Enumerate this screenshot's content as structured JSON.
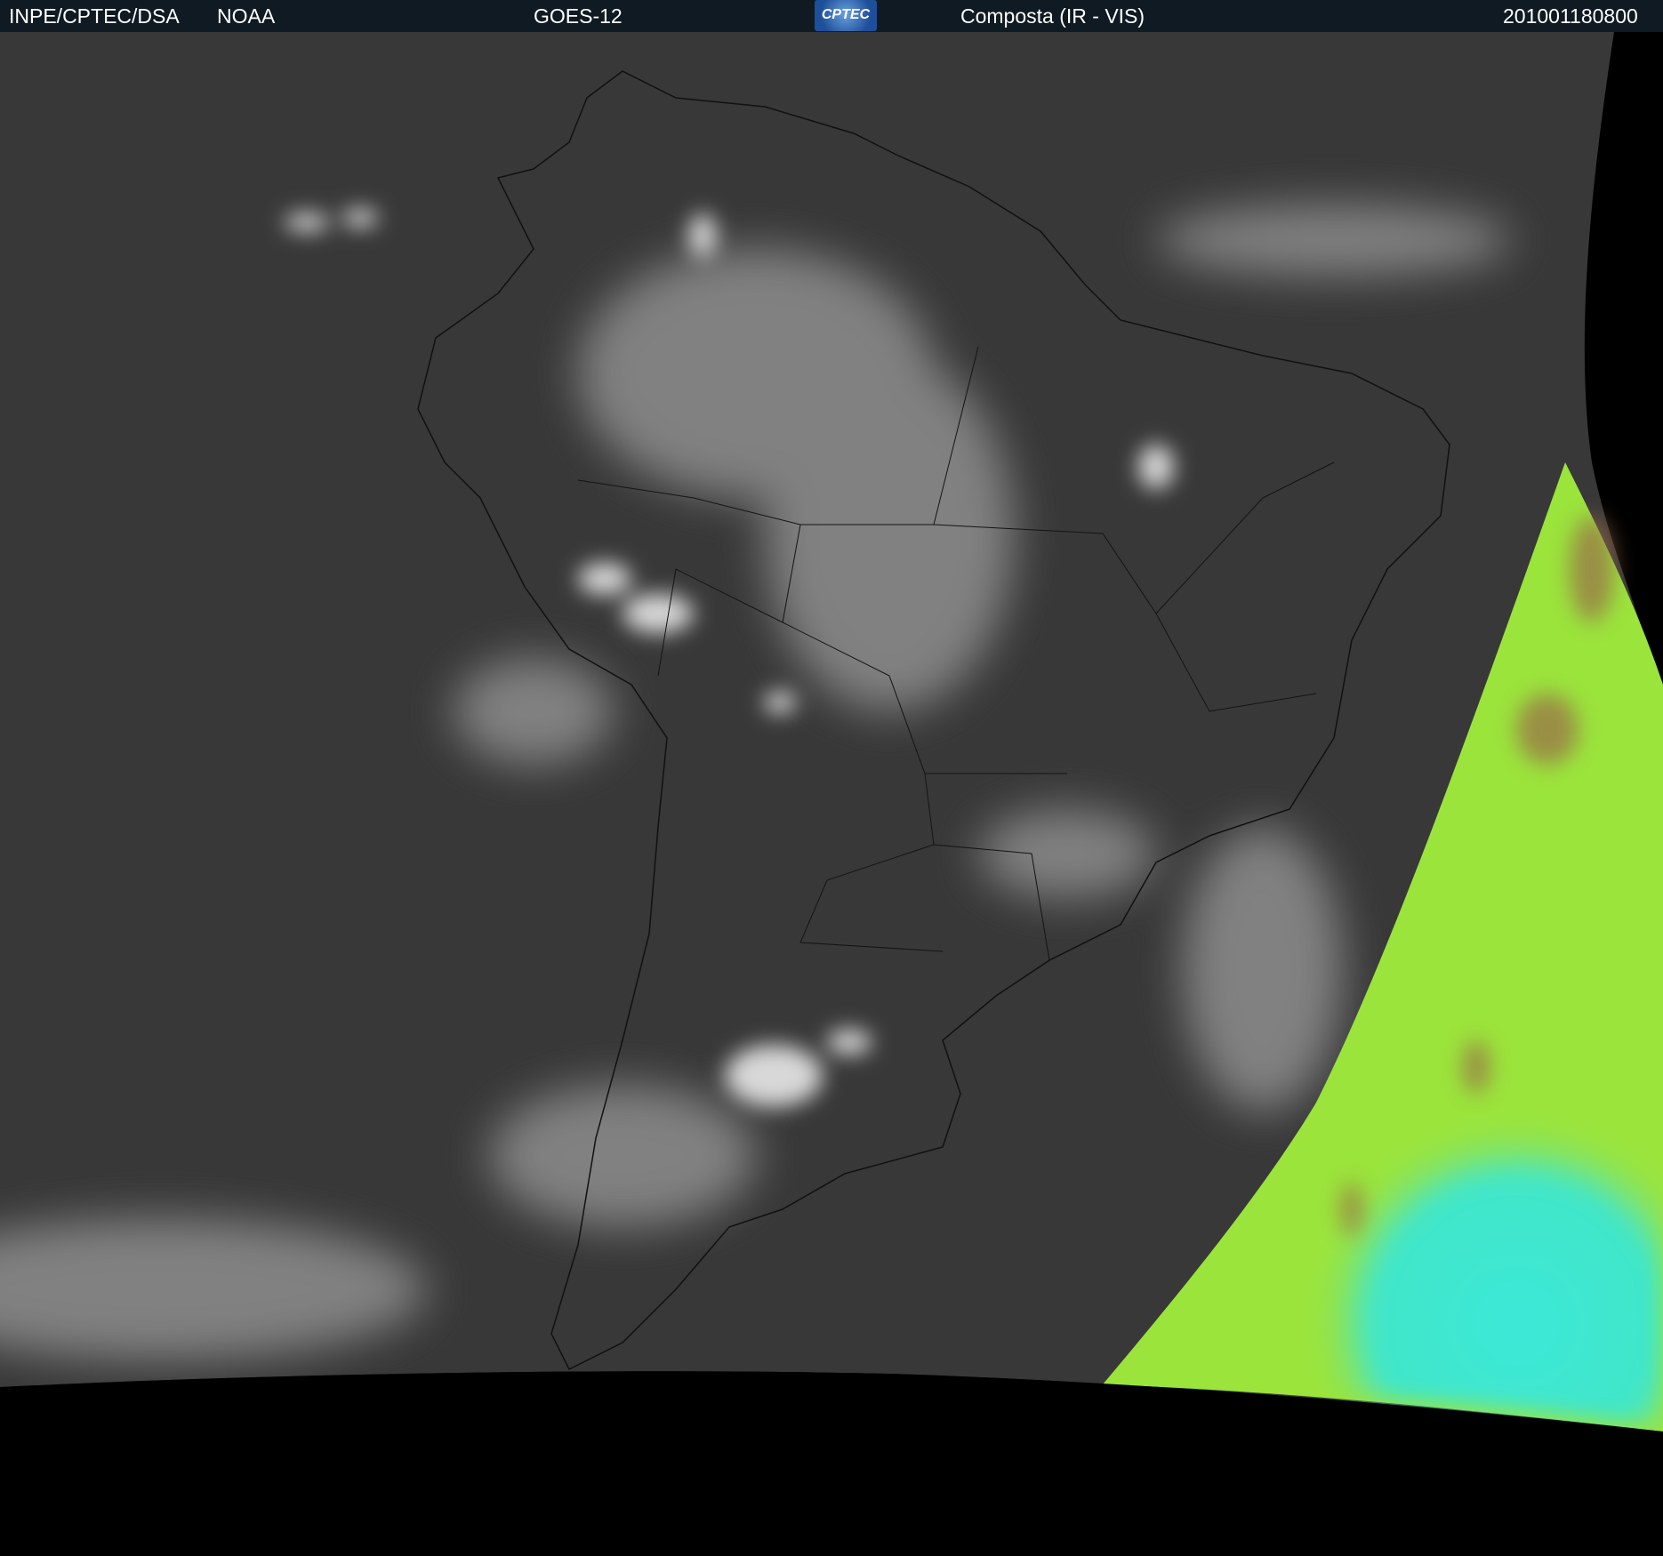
{
  "header": {
    "institution": "INPE/CPTEC/DSA",
    "agency": "NOAA",
    "satellite": "GOES-12",
    "logo_text": "CPTEC",
    "product": "Composta (IR - VIS)",
    "timestamp": "201001180800"
  },
  "colors": {
    "header_bg": "#101a22",
    "ocean_gray": "#3a3a3a",
    "space": "#000000",
    "vis_green": "#9be43c",
    "vis_cyan": "#3ce8d8",
    "vis_brown": "#9a6a4a"
  }
}
